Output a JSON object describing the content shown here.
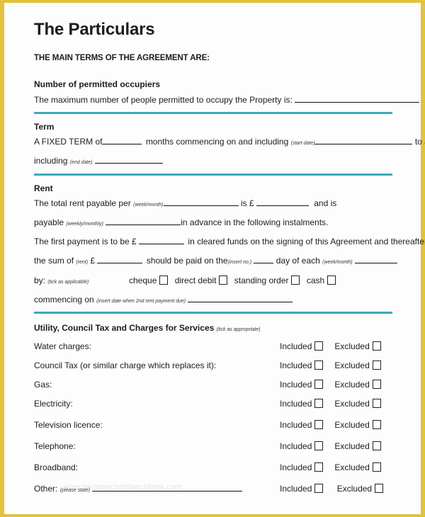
{
  "document": {
    "title": "The Particulars",
    "subtitle": "THE MAIN TERMS OF THE AGREEMENT ARE:",
    "occupiers": {
      "heading": "Number of permitted occupiers",
      "text": "The maximum number of people permitted to occupy the Property is:",
      "value": ""
    },
    "term": {
      "heading": "Term",
      "line1_prefix": "A FIXED TERM of",
      "line1_mid": "months commencing on and including",
      "start_hint": "(start date)",
      "line1_suffix": "to and",
      "line2_prefix": "including",
      "end_hint": "(end date)",
      "months_value": "",
      "start_value": "",
      "end_value": ""
    },
    "rent": {
      "heading": "Rent",
      "l1_prefix": "The total rent payable per",
      "l1_hint": "(week/month)",
      "l1_mid": "is £",
      "l1_suffix": "and is",
      "l2_prefix": "payable",
      "l2_hint": "(weekly/monthly)",
      "l2_suffix": "in advance in the following instalments.",
      "l3_prefix": "The first payment is to be £",
      "l3_suffix": "in cleared funds on the signing of this Agreement and thereafter",
      "l4_prefix": "the sum of",
      "l4_hint": "(rent)",
      "l4_pound": "£",
      "l4_mid": "should be paid on the",
      "l4_hint2": "(insert no.)",
      "l4_mid2": "day of each",
      "l4_hint3": "(week/month)",
      "l5_prefix": "by:",
      "l5_hint": "(tick as applicable)",
      "methods": [
        "cheque",
        "direct debit",
        "standing order",
        "cash"
      ],
      "l6_prefix": "commencing on",
      "l6_hint": "(insert date when 2nd rent payment due)"
    },
    "utility": {
      "heading": "Utility, Council Tax and Charges for Services",
      "hint": "(tick as appropriate)",
      "included_label": "Included",
      "excluded_label": "Excluded",
      "items": [
        "Water charges:",
        "Council Tax (or similar charge which replaces it):",
        "Gas:",
        "Electricity:",
        "Television licence:",
        "Telephone:",
        "Broadband:"
      ],
      "other_label": "Other:",
      "other_hint": "(please state)"
    },
    "watermark": "www.heritagechristiancollege.com"
  },
  "colors": {
    "frame": "#e2c23e",
    "divider": "#3ea9b6"
  }
}
